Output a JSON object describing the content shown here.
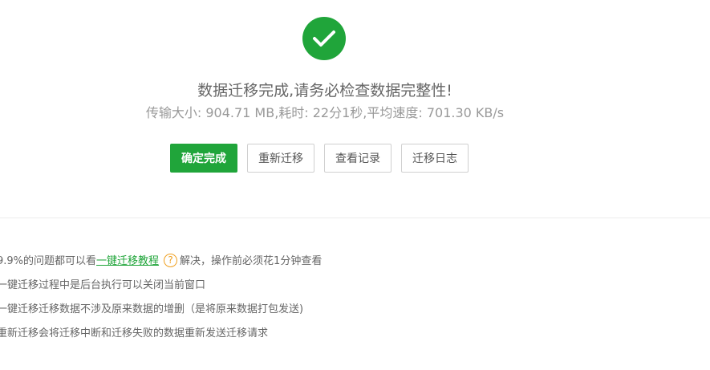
{
  "result": {
    "title": "数据迁移完成,请务必检查数据完整性!",
    "stats": "传输大小: 904.71 MB,耗时: 22分1秒,平均速度: 701.30 KB/s",
    "icon": "check-icon",
    "accent_color": "#20a53a"
  },
  "buttons": {
    "confirm": "确定完成",
    "remigrate": "重新迁移",
    "records": "查看记录",
    "log": "迁移日志"
  },
  "tips": {
    "item1_prefix": "9.9%的问题都可以看",
    "item1_link": "一键迁移教程",
    "item1_help": "?",
    "item1_suffix": "解决，操作前必须花1分钟查看",
    "item2": "一键迁移过程中是后台执行可以关闭当前窗口",
    "item3": "一键迁移迁移数据不涉及原来数据的增删（是将原来数据打包发送)",
    "item4": "重新迁移会将迁移中断和迁移失败的数据重新发送迁移请求"
  }
}
